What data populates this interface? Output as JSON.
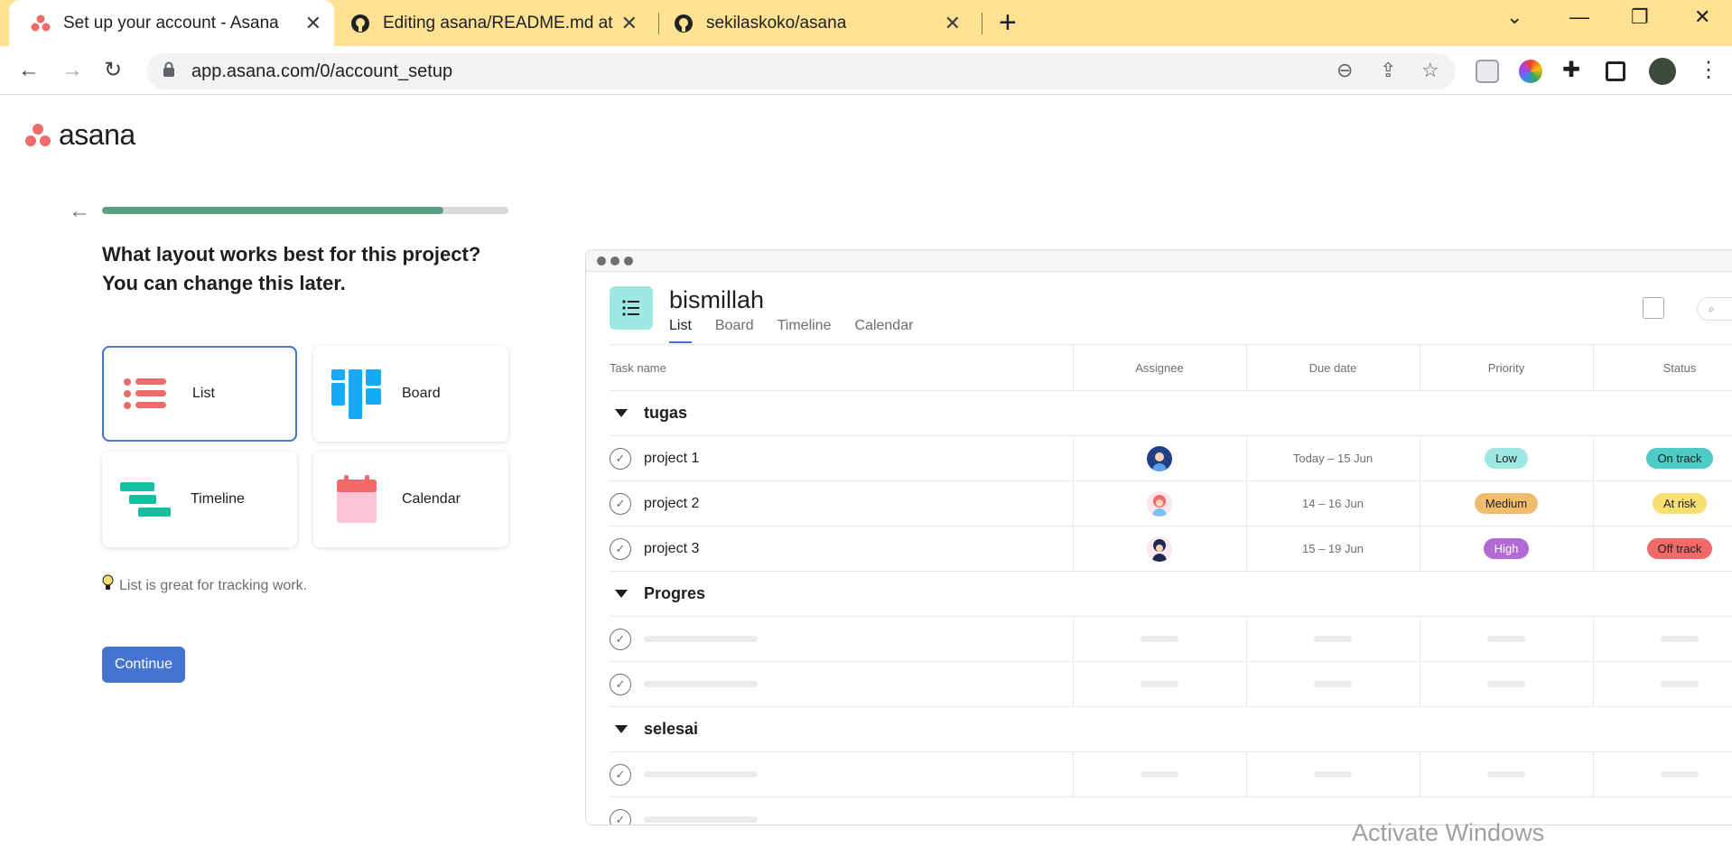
{
  "browser": {
    "tabs": [
      {
        "title": "Set up your account - Asana",
        "active": true
      },
      {
        "title": "Editing asana/README.md at ma",
        "active": false
      },
      {
        "title": "sekilaskoko/asana",
        "active": false
      }
    ],
    "url": "app.asana.com/0/account_setup"
  },
  "brand": {
    "name": "asana",
    "accent": "#f06a6a"
  },
  "setup": {
    "progress_fraction": 0.84,
    "question": "What layout works best for this project? You can change this later.",
    "options": [
      {
        "label": "List",
        "icon": "list-icon",
        "selected": true
      },
      {
        "label": "Board",
        "icon": "board-icon",
        "selected": false
      },
      {
        "label": "Timeline",
        "icon": "timeline-icon",
        "selected": false
      },
      {
        "label": "Calendar",
        "icon": "calendar-icon",
        "selected": false
      }
    ],
    "hint": "List is great for tracking work.",
    "continue_label": "Continue"
  },
  "preview": {
    "project_name": "bismillah",
    "tabs": [
      "List",
      "Board",
      "Timeline",
      "Calendar"
    ],
    "columns": [
      "Task name",
      "Assignee",
      "Due date",
      "Priority",
      "Status"
    ],
    "sections": [
      {
        "name": "tugas"
      },
      {
        "name": "Progres"
      },
      {
        "name": "selesai"
      }
    ],
    "tasks": [
      {
        "name": "project 1",
        "due": "Today – 15 Jun",
        "priority": "Low",
        "priority_color": "#9ee7e3",
        "status": "On track",
        "status_color": "#4ecbc4"
      },
      {
        "name": "project 2",
        "due": "14 – 16 Jun",
        "priority": "Medium",
        "priority_color": "#f1bd6c",
        "status": "At risk",
        "status_color": "#f8df72"
      },
      {
        "name": "project 3",
        "due": "15 – 19 Jun",
        "priority": "High",
        "priority_color": "#b36bd4",
        "status": "Off track",
        "status_color": "#f06a6a"
      }
    ]
  },
  "watermark": "Activate Windows"
}
